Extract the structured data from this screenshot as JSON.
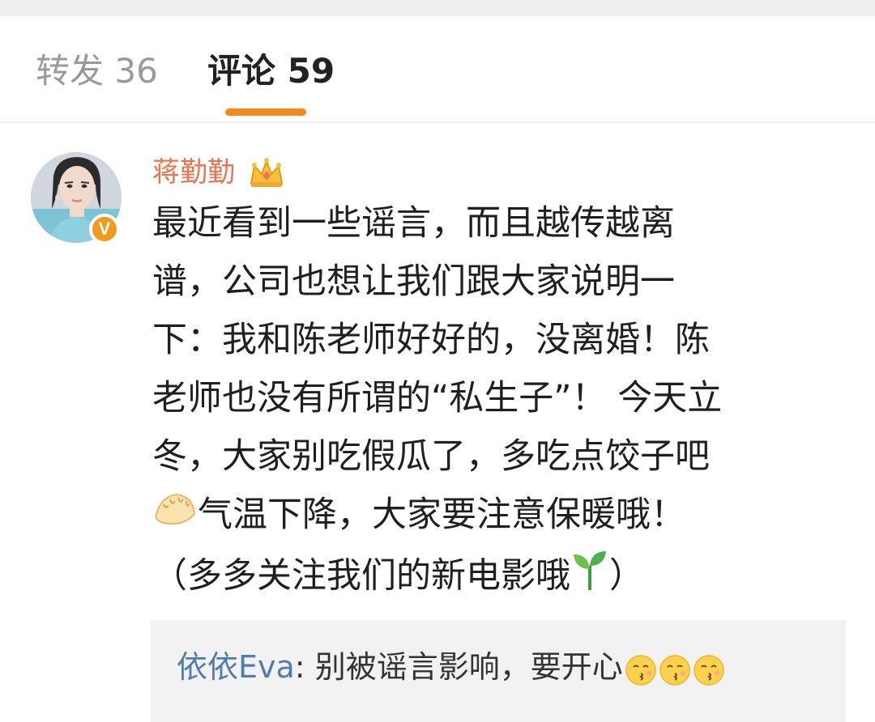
{
  "tabs": {
    "repost_label": "转发 36",
    "comments_label": "评论 59"
  },
  "comment": {
    "username": "蒋勤勤",
    "verified_mark": "V",
    "lines": [
      "最近看到一些谣言，而且越传越离",
      "谱，公司也想让我们跟大家说明一",
      "下：我和陈老师好好的，没离婚！陈",
      "老师也没有所谓的“私生子”！ 今天立",
      "冬，大家别吃假瓜了，多吃点饺子吧",
      "气温下降，大家要注意保暖哦！",
      "（多多关注我们的新电影哦",
      "）"
    ],
    "icons": {
      "crown": "crown-icon",
      "dumpling": "dumpling-icon",
      "sprout": "sprout-icon",
      "kiss": "kiss-face-icon"
    },
    "reply": {
      "author": "依依Eva",
      "separator": ": ",
      "text": "别被谣言影响，要开心"
    }
  },
  "colors": {
    "accent_orange": "#f28a1d",
    "username_orange": "#eb7350",
    "reply_author_blue": "#507daf",
    "reply_bg": "#f2f2f2"
  }
}
